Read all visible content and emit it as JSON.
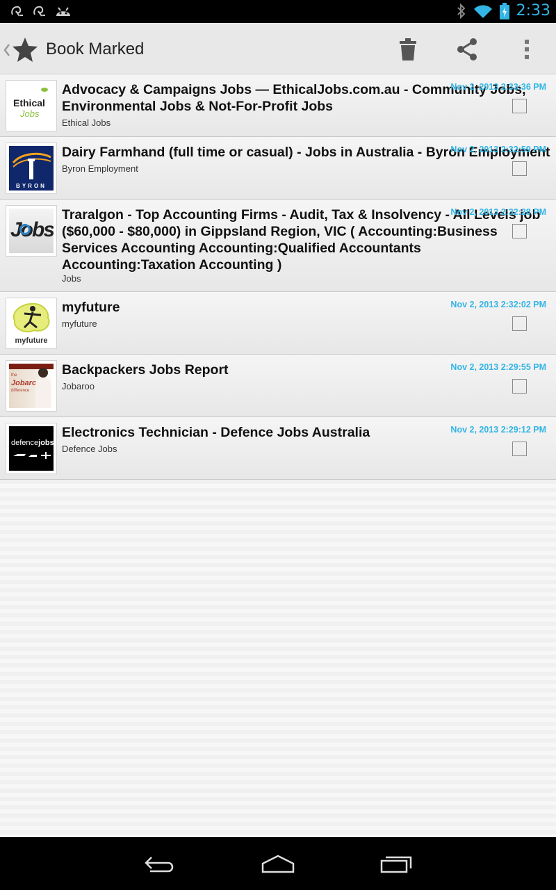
{
  "status_bar": {
    "time": "2:33",
    "icons": [
      "notification-icon",
      "notification-icon",
      "android-icon",
      "bluetooth-icon",
      "wifi-icon",
      "battery-charging-icon"
    ]
  },
  "action_bar": {
    "title": "Book Marked",
    "icons": [
      "back-chevron-icon",
      "star-icon",
      "trash-icon",
      "share-icon",
      "overflow-menu-icon"
    ]
  },
  "bookmarks": [
    {
      "title": "Advocacy & Campaigns Jobs — EthicalJobs.com.au - Community Jobs, Environmental Jobs & Not-For-Profit Jobs",
      "source": "Ethical Jobs",
      "date": "Nov 2, 2013 2:33:36 PM",
      "logo": "ethical-jobs-logo",
      "logo_text": "Ethical Jobs"
    },
    {
      "title": "Dairy Farmhand (full time or casual) - Jobs in Australia - Byron Employment",
      "source": "Byron Employment",
      "date": "Nov 2, 2013 2:32:59 PM",
      "logo": "byron-logo",
      "logo_text": "BYRON"
    },
    {
      "title": "Traralgon - Top Accounting Firms - Audit, Tax & Insolvency - All Levels job ($60,000 - $80,000) in Gippsland Region, VIC ( Accounting:Business Services Accounting Accounting:Qualified Accountants Accounting:Taxation Accounting )",
      "source": "Jobs",
      "date": "Nov 2, 2013 2:32:28 PM",
      "logo": "jobs-logo",
      "logo_text": "Jobs"
    },
    {
      "title": "myfuture",
      "source": "myfuture",
      "date": "Nov 2, 2013 2:32:02 PM",
      "logo": "myfuture-logo",
      "logo_text": "myfuture"
    },
    {
      "title": "Backpackers Jobs Report",
      "source": "Jobaroo",
      "date": "Nov 2, 2013 2:29:55 PM",
      "logo": "jobaroo-logo",
      "logo_text": "the Jobaroo difference"
    },
    {
      "title": "Electronics Technician - Defence Jobs Australia",
      "source": "Defence Jobs",
      "date": "Nov 2, 2013 2:29:12 PM",
      "logo": "defence-jobs-logo",
      "logo_text": "defencejobs"
    }
  ],
  "nav_bar": {
    "icons": [
      "back-icon",
      "home-icon",
      "recent-apps-icon"
    ]
  },
  "colors": {
    "accent": "#33b5e5",
    "status_bar": "#000000",
    "action_bar": "#e8e8e8"
  }
}
